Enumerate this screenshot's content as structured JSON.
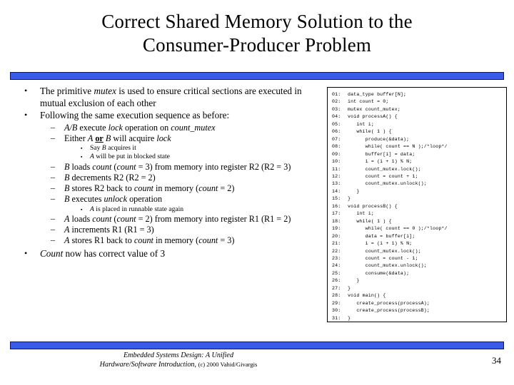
{
  "slide": {
    "title_lines": [
      "Correct Shared Memory Solution to the",
      "Consumer-Producer Problem"
    ],
    "accent_color": "#3A5BE8",
    "accent_border_color": "#14145A",
    "page_number": "34"
  },
  "bullets": {
    "b1": "The primitive mutex is used to ensure critical sections are executed in mutual exclusion of each other",
    "b2": "Following the same execution sequence as before:",
    "s1": "A/B execute lock operation on count_mutex",
    "s2": "Either A or B will acquire lock",
    "t1": "Say B acquires it",
    "t2": "A will be put in blocked state",
    "s3": "B loads count (count = 3) from memory into register R2 (R2 = 3)",
    "s4": "B decrements R2 (R2 = 2)",
    "s5": "B stores R2 back to count in memory (count = 2)",
    "s6": "B executes unlock operation",
    "t3": "A is placed in runnable state again",
    "s7": "A loads count (count = 2) from memory into register R1 (R1 = 2)",
    "s8": "A increments R1 (R1 = 3)",
    "s9": "A stores R1 back to count in memory (count = 3)",
    "b3": "Count now has correct value of 3"
  },
  "code": {
    "lines": [
      {
        "n": "01:",
        "text": "data_type buffer[N];"
      },
      {
        "n": "02:",
        "text": "int count = 0;"
      },
      {
        "n": "03:",
        "text": "mutex count_mutex;"
      },
      {
        "n": "04:",
        "text": "void processA() {"
      },
      {
        "n": "05:",
        "text": "   int i;"
      },
      {
        "n": "06:",
        "text": "   while( 1 ) {"
      },
      {
        "n": "07:",
        "text": "      produce(&data);"
      },
      {
        "n": "08:",
        "text": "      while( count == N );/*loop*/"
      },
      {
        "n": "09:",
        "text": "      buffer[i] = data;"
      },
      {
        "n": "10:",
        "text": "      i = (i + 1) % N;"
      },
      {
        "n": "11:",
        "text": "      count_mutex.lock();"
      },
      {
        "n": "12:",
        "text": "      count = count + 1;"
      },
      {
        "n": "13:",
        "text": "      count_mutex.unlock();"
      },
      {
        "n": "14:",
        "text": "   }"
      },
      {
        "n": "15:",
        "text": "}"
      },
      {
        "n": "16:",
        "text": "void processB() {"
      },
      {
        "n": "17:",
        "text": "   int i;"
      },
      {
        "n": "18:",
        "text": "   while( 1 ) {"
      },
      {
        "n": "19:",
        "text": "      while( count == 0 );/*loop*/"
      },
      {
        "n": "20:",
        "text": "      data = buffer[i];"
      },
      {
        "n": "21:",
        "text": "      i = (i + 1) % N;"
      },
      {
        "n": "22:",
        "text": "      count_mutex.lock();"
      },
      {
        "n": "23:",
        "text": "      count = count - 1;"
      },
      {
        "n": "24:",
        "text": "      count_mutex.unlock();"
      },
      {
        "n": "25:",
        "text": "      consume(&data);"
      },
      {
        "n": "26:",
        "text": "   }"
      },
      {
        "n": "27:",
        "text": "}"
      },
      {
        "n": "28:",
        "text": "void main() {"
      },
      {
        "n": "29:",
        "text": "   create_process(processA);"
      },
      {
        "n": "30:",
        "text": "   create_process(processB);"
      },
      {
        "n": "31:",
        "text": "}"
      }
    ]
  },
  "footer": {
    "line1": "Embedded Systems Design: A Unified",
    "line2a": "Hardware/Software Introduction,",
    "line2b": "(c) 2000 Vahid/Givargis"
  }
}
